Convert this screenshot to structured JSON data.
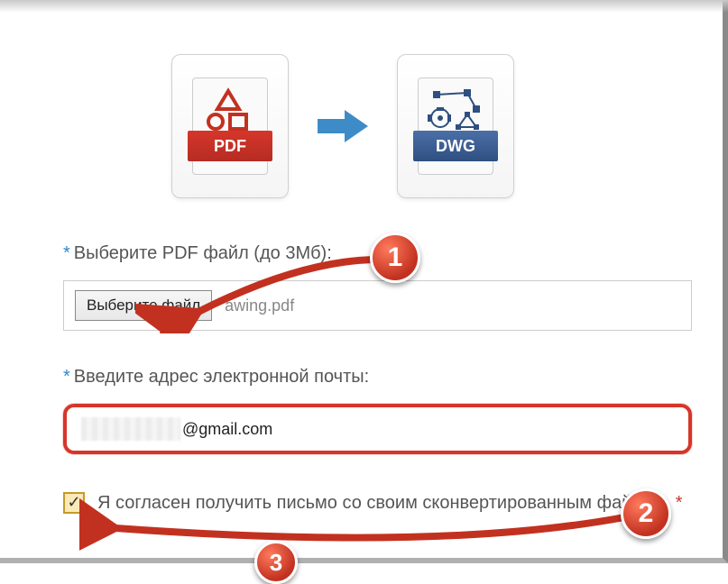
{
  "icons": {
    "pdf_band": "PDF",
    "dwg_band": "DWG"
  },
  "file": {
    "label_prefix": "*",
    "label": "Выберите PDF файл (до 3Мб):",
    "choose_button": "Выберите файл",
    "selected_name": "awing.pdf"
  },
  "email": {
    "label_prefix": "*",
    "label": "Введите адрес электронной почты:",
    "value_domain": "@gmail.com"
  },
  "consent": {
    "checked_mark": "✓",
    "text": "Я согласен получить письмо со своим сконвертированным файлом.",
    "asterisk": "*"
  },
  "annotations": {
    "badge1": "1",
    "badge2": "2",
    "badge3": "3"
  }
}
